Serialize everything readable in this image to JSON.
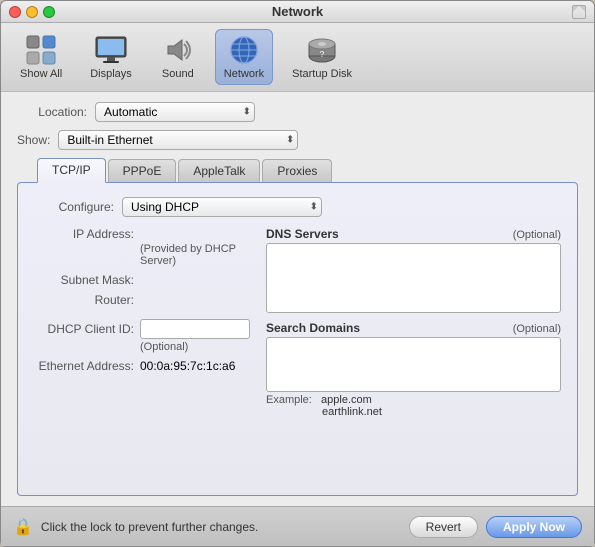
{
  "window": {
    "title": "Network"
  },
  "toolbar": {
    "items": [
      {
        "id": "show-all",
        "label": "Show All",
        "icon": "⊞"
      },
      {
        "id": "displays",
        "label": "Displays",
        "icon": "🖥"
      },
      {
        "id": "sound",
        "label": "Sound",
        "icon": "🔊"
      },
      {
        "id": "network",
        "label": "Network",
        "icon": "🌐",
        "active": true
      },
      {
        "id": "startup-disk",
        "label": "Startup Disk",
        "icon": "💽"
      }
    ]
  },
  "location": {
    "label": "Location:",
    "value": "Automatic"
  },
  "show": {
    "label": "Show:",
    "value": "Built-in Ethernet"
  },
  "tabs": [
    {
      "id": "tcpip",
      "label": "TCP/IP",
      "active": true
    },
    {
      "id": "pppoe",
      "label": "PPPoE",
      "active": false
    },
    {
      "id": "appletalk",
      "label": "AppleTalk",
      "active": false
    },
    {
      "id": "proxies",
      "label": "Proxies",
      "active": false
    }
  ],
  "configure": {
    "label": "Configure:",
    "value": "Using DHCP"
  },
  "fields": {
    "ip_address": {
      "label": "IP Address:",
      "value": "",
      "hint": "(Provided by DHCP Server)"
    },
    "subnet_mask": {
      "label": "Subnet Mask:",
      "value": ""
    },
    "router": {
      "label": "Router:",
      "value": ""
    },
    "dhcp_client_id": {
      "label": "DHCP Client ID:",
      "value": "",
      "hint": "(Optional)"
    },
    "ethernet_address": {
      "label": "Ethernet Address:",
      "value": "00:0a:95:7c:1c:a6"
    }
  },
  "dns": {
    "title": "DNS Servers",
    "optional": "(Optional)"
  },
  "search": {
    "title": "Search Domains",
    "optional": "(Optional)"
  },
  "example": {
    "label": "Example:",
    "values": [
      "apple.com",
      "earthlink.net"
    ]
  },
  "bottom": {
    "lock_text": "Click the lock to prevent further changes.",
    "revert_label": "Revert",
    "apply_label": "Apply Now"
  }
}
